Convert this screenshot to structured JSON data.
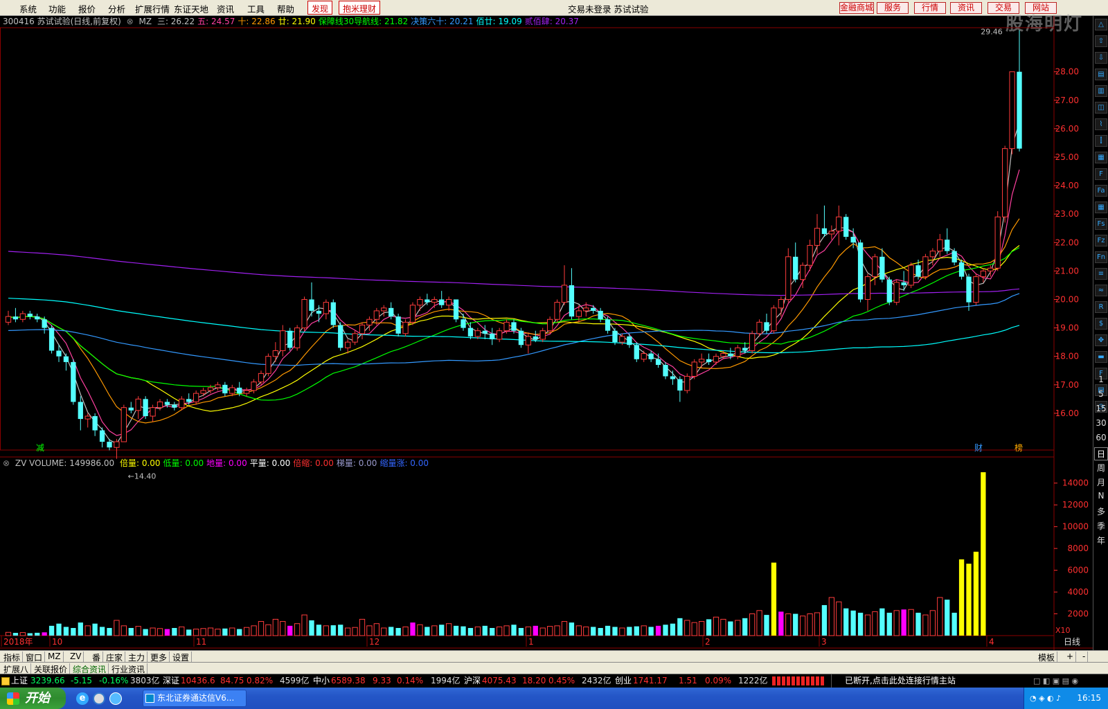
{
  "menu": {
    "items": [
      "系统",
      "功能",
      "报价",
      "分析",
      "扩展行情",
      "东证天地",
      "资讯",
      "工具",
      "帮助"
    ],
    "discover": "发现",
    "bao": "抱米理财",
    "center": "交易未登录  苏试试验",
    "right_buttons": [
      "金融商城",
      "服务",
      "行情",
      "资讯",
      "交易",
      "网站"
    ],
    "watermark": "股海明灯"
  },
  "header": {
    "code": "300416 苏试试验(日线,前复权)",
    "mz": "MZ",
    "items": [
      {
        "label": "三: 26.22",
        "color": "#c0c0c0"
      },
      {
        "label": "五: 24.57",
        "color": "#ff40a0"
      },
      {
        "label": "十: 22.86",
        "color": "#ff9900"
      },
      {
        "label": "廿: 21.90",
        "color": "#ffff00"
      },
      {
        "label": "保障线30导航线: 21.82",
        "color": "#00ff00"
      },
      {
        "label": "决策六十: 20.21",
        "color": "#3399ff"
      },
      {
        "label": "佰廿: 19.09",
        "color": "#00ffff"
      },
      {
        "label": "贰佰肆: 20.37",
        "color": "#a020f0"
      }
    ]
  },
  "chart_data": {
    "type": "candlestick",
    "y_axis": {
      "min": 15.0,
      "max": 29.5,
      "ticks": [
        16,
        17,
        18,
        19,
        20,
        21,
        22,
        23,
        24,
        25,
        26,
        27,
        28
      ]
    },
    "annotations": {
      "high": "29.46",
      "low": "14.40",
      "jian": "减",
      "cai": "财",
      "bang": "榜"
    },
    "x_months": [
      "2018年",
      "10",
      "11",
      "12",
      "1",
      "2",
      "3",
      "4"
    ],
    "period": "日线",
    "candles": [
      [
        19.2,
        19.6,
        19.1,
        19.4
      ],
      [
        19.4,
        19.7,
        19.2,
        19.3
      ],
      [
        19.3,
        19.6,
        19.2,
        19.5
      ],
      [
        19.5,
        19.6,
        19.3,
        19.4
      ],
      [
        19.4,
        19.5,
        19.2,
        19.3
      ],
      [
        19.3,
        19.4,
        18.8,
        19.0
      ],
      [
        19.0,
        19.1,
        18.1,
        18.2
      ],
      [
        18.2,
        18.4,
        17.8,
        18.0
      ],
      [
        18.0,
        18.1,
        17.5,
        17.8
      ],
      [
        17.8,
        17.9,
        16.3,
        16.4
      ],
      [
        16.4,
        16.6,
        15.4,
        15.8
      ],
      [
        15.8,
        16.0,
        15.5,
        15.9
      ],
      [
        15.9,
        16.0,
        15.2,
        15.4
      ],
      [
        15.4,
        15.5,
        14.8,
        15.0
      ],
      [
        15.0,
        15.1,
        14.7,
        14.8
      ],
      [
        14.8,
        15.1,
        14.4,
        15.0
      ],
      [
        15.0,
        16.3,
        15.0,
        16.2
      ],
      [
        16.2,
        16.4,
        16.0,
        16.1
      ],
      [
        16.1,
        16.6,
        15.8,
        16.5
      ],
      [
        16.5,
        16.6,
        15.8,
        15.9
      ],
      [
        15.9,
        16.3,
        15.7,
        16.2
      ],
      [
        16.2,
        16.5,
        16.1,
        16.4
      ],
      [
        16.4,
        16.5,
        16.2,
        16.3
      ],
      [
        16.3,
        16.4,
        16.1,
        16.2
      ],
      [
        16.2,
        16.6,
        16.1,
        16.5
      ],
      [
        16.5,
        16.7,
        16.3,
        16.4
      ],
      [
        16.4,
        16.8,
        16.3,
        16.7
      ],
      [
        16.7,
        16.9,
        16.6,
        16.8
      ],
      [
        16.8,
        17.0,
        16.7,
        16.9
      ],
      [
        16.9,
        17.1,
        16.8,
        17.0
      ],
      [
        17.0,
        17.1,
        16.6,
        16.7
      ],
      [
        16.7,
        17.0,
        16.6,
        16.9
      ],
      [
        16.9,
        17.1,
        16.6,
        16.7
      ],
      [
        16.7,
        16.9,
        16.6,
        16.8
      ],
      [
        16.8,
        17.2,
        16.7,
        17.1
      ],
      [
        17.1,
        17.5,
        17.0,
        17.4
      ],
      [
        17.4,
        18.1,
        17.3,
        18.0
      ],
      [
        18.0,
        18.5,
        17.8,
        18.2
      ],
      [
        18.2,
        19.1,
        18.0,
        18.9
      ],
      [
        18.9,
        19.0,
        18.2,
        18.3
      ],
      [
        18.3,
        19.1,
        18.2,
        19.0
      ],
      [
        19.0,
        20.1,
        18.9,
        20.0
      ],
      [
        20.0,
        20.6,
        19.4,
        19.6
      ],
      [
        19.6,
        19.8,
        19.2,
        19.5
      ],
      [
        19.5,
        20.0,
        19.3,
        19.9
      ],
      [
        19.9,
        20.0,
        19.0,
        19.1
      ],
      [
        19.1,
        19.2,
        18.2,
        18.3
      ],
      [
        18.3,
        18.6,
        18.1,
        18.5
      ],
      [
        18.5,
        18.9,
        18.4,
        18.8
      ],
      [
        18.8,
        19.2,
        18.6,
        19.1
      ],
      [
        19.1,
        19.4,
        18.9,
        19.3
      ],
      [
        19.3,
        19.7,
        19.1,
        19.6
      ],
      [
        19.6,
        19.8,
        19.4,
        19.7
      ],
      [
        19.7,
        19.9,
        19.3,
        19.4
      ],
      [
        19.4,
        19.5,
        18.7,
        18.8
      ],
      [
        18.8,
        19.3,
        18.7,
        19.2
      ],
      [
        19.2,
        19.9,
        19.1,
        19.8
      ],
      [
        19.8,
        20.1,
        19.6,
        20.0
      ],
      [
        20.0,
        20.2,
        19.8,
        19.9
      ],
      [
        19.9,
        20.1,
        19.7,
        20.0
      ],
      [
        20.0,
        20.3,
        19.7,
        19.8
      ],
      [
        19.8,
        20.1,
        19.6,
        20.0
      ],
      [
        20.0,
        20.0,
        19.2,
        19.3
      ],
      [
        19.3,
        19.5,
        18.9,
        19.0
      ],
      [
        19.0,
        19.2,
        18.6,
        18.7
      ],
      [
        18.7,
        19.0,
        18.6,
        18.9
      ],
      [
        18.9,
        19.1,
        18.6,
        18.8
      ],
      [
        18.8,
        19.0,
        18.4,
        18.6
      ],
      [
        18.6,
        19.0,
        18.5,
        18.9
      ],
      [
        18.9,
        19.3,
        18.8,
        19.2
      ],
      [
        19.2,
        19.3,
        18.8,
        18.9
      ],
      [
        18.9,
        19.0,
        18.3,
        18.4
      ],
      [
        18.4,
        18.8,
        18.1,
        18.7
      ],
      [
        18.7,
        18.9,
        18.5,
        18.6
      ],
      [
        18.6,
        19.0,
        18.5,
        18.9
      ],
      [
        18.9,
        19.4,
        18.8,
        19.3
      ],
      [
        19.3,
        20.0,
        19.2,
        19.9
      ],
      [
        19.9,
        21.2,
        19.8,
        20.5
      ],
      [
        20.5,
        21.1,
        19.3,
        19.4
      ],
      [
        19.4,
        19.8,
        19.2,
        19.6
      ],
      [
        19.6,
        19.9,
        19.4,
        19.7
      ],
      [
        19.7,
        19.8,
        19.5,
        19.6
      ],
      [
        19.6,
        19.7,
        19.2,
        19.3
      ],
      [
        19.3,
        19.4,
        18.8,
        18.9
      ],
      [
        18.9,
        19.0,
        18.4,
        18.5
      ],
      [
        18.5,
        18.8,
        18.4,
        18.7
      ],
      [
        18.7,
        18.8,
        18.3,
        18.4
      ],
      [
        18.4,
        18.5,
        17.8,
        17.9
      ],
      [
        17.9,
        18.2,
        17.8,
        18.1
      ],
      [
        18.1,
        18.2,
        17.8,
        17.9
      ],
      [
        17.9,
        18.1,
        17.6,
        17.7
      ],
      [
        17.7,
        17.8,
        17.2,
        17.3
      ],
      [
        17.3,
        17.5,
        17.0,
        17.2
      ],
      [
        17.2,
        17.3,
        16.4,
        16.8
      ],
      [
        16.8,
        17.4,
        16.7,
        17.3
      ],
      [
        17.3,
        17.9,
        17.2,
        17.8
      ],
      [
        17.8,
        18.1,
        17.6,
        17.9
      ],
      [
        17.9,
        18.1,
        17.7,
        17.8
      ],
      [
        17.8,
        18.1,
        17.7,
        18.0
      ],
      [
        18.0,
        18.2,
        17.9,
        18.1
      ],
      [
        18.1,
        18.3,
        17.9,
        18.0
      ],
      [
        18.0,
        18.4,
        17.9,
        18.3
      ],
      [
        18.3,
        18.5,
        18.1,
        18.2
      ],
      [
        18.2,
        18.9,
        18.1,
        18.8
      ],
      [
        18.8,
        19.3,
        18.7,
        19.2
      ],
      [
        19.2,
        19.5,
        18.8,
        18.9
      ],
      [
        18.9,
        19.8,
        18.8,
        19.7
      ],
      [
        19.7,
        20.1,
        19.4,
        20.0
      ],
      [
        20.0,
        21.8,
        19.9,
        21.5
      ],
      [
        21.5,
        22.0,
        20.6,
        20.7
      ],
      [
        20.7,
        21.3,
        20.4,
        21.2
      ],
      [
        21.2,
        22.1,
        21.0,
        21.9
      ],
      [
        21.9,
        23.0,
        21.6,
        22.5
      ],
      [
        22.5,
        23.3,
        22.2,
        22.3
      ],
      [
        22.3,
        22.6,
        22.1,
        22.4
      ],
      [
        22.4,
        23.3,
        21.9,
        22.9
      ],
      [
        22.9,
        23.0,
        22.1,
        22.2
      ],
      [
        22.2,
        22.5,
        21.8,
        22.0
      ],
      [
        22.0,
        22.1,
        19.9,
        20.0
      ],
      [
        20.0,
        20.9,
        19.6,
        20.8
      ],
      [
        20.8,
        21.6,
        20.5,
        21.5
      ],
      [
        21.5,
        21.8,
        20.6,
        20.7
      ],
      [
        20.7,
        20.8,
        19.8,
        19.9
      ],
      [
        19.9,
        20.7,
        19.8,
        20.6
      ],
      [
        20.6,
        21.0,
        20.3,
        20.5
      ],
      [
        20.5,
        21.3,
        20.4,
        21.2
      ],
      [
        21.2,
        21.4,
        20.7,
        20.8
      ],
      [
        20.8,
        21.6,
        20.7,
        21.5
      ],
      [
        21.5,
        21.8,
        21.2,
        21.7
      ],
      [
        21.7,
        22.3,
        21.5,
        22.1
      ],
      [
        22.1,
        22.5,
        21.6,
        21.7
      ],
      [
        21.7,
        21.8,
        21.2,
        21.3
      ],
      [
        21.3,
        21.4,
        20.7,
        20.8
      ],
      [
        20.8,
        20.9,
        19.6,
        19.9
      ],
      [
        19.9,
        20.9,
        19.8,
        20.8
      ],
      [
        20.8,
        21.1,
        20.6,
        21.0
      ],
      [
        21.0,
        21.2,
        20.8,
        21.1
      ],
      [
        21.1,
        23.1,
        21.0,
        22.9
      ],
      [
        22.9,
        25.4,
        22.7,
        25.3
      ],
      [
        25.3,
        28.0,
        25.1,
        28.0
      ],
      [
        28.0,
        29.46,
        25.2,
        25.3
      ]
    ],
    "ma": [
      {
        "name": "三",
        "color": "#c0c0c0",
        "end": 26.22
      },
      {
        "name": "五",
        "color": "#ff40a0",
        "end": 24.57
      },
      {
        "name": "十",
        "color": "#ff9900",
        "end": 22.86
      },
      {
        "name": "廿",
        "color": "#ffff00",
        "end": 21.9
      },
      {
        "name": "保障线30导航线",
        "color": "#00ff00",
        "end": 21.82
      },
      {
        "name": "决策六十",
        "color": "#3399ff",
        "end": 20.21
      },
      {
        "name": "佰廿",
        "color": "#00ffff",
        "end": 19.09
      },
      {
        "name": "贰佰肆",
        "color": "#a020f0",
        "end": 20.37
      }
    ],
    "volume": {
      "y_axis": {
        "min": 0,
        "max": 15000,
        "ticks": [
          2000,
          4000,
          6000,
          8000,
          10000,
          12000,
          14000
        ]
      },
      "unit": "X10",
      "values": [
        300,
        250,
        280,
        220,
        260,
        300,
        900,
        1100,
        800,
        700,
        1200,
        900,
        1100,
        800,
        700,
        1400,
        900,
        700,
        850,
        600,
        700,
        650,
        600,
        700,
        800,
        550,
        600,
        650,
        700,
        600,
        650,
        700,
        600,
        750,
        900,
        1300,
        1000,
        1500,
        1300,
        900,
        1100,
        1900,
        1400,
        1000,
        900,
        950,
        1000,
        700,
        750,
        1500,
        900,
        1100,
        700,
        800,
        700,
        800,
        1200,
        1000,
        800,
        900,
        1000,
        1100,
        900,
        850,
        700,
        800,
        900,
        700,
        800,
        900,
        1000,
        700,
        800,
        900,
        700,
        850,
        900,
        1300,
        1200,
        900,
        800,
        800,
        700,
        900,
        800,
        700,
        800,
        850,
        900,
        800,
        900,
        1000,
        1100,
        1600,
        1400,
        1200,
        1300,
        1500,
        1700,
        1500,
        1300,
        1400,
        1600,
        2000,
        2300,
        1900,
        6700,
        2200,
        2000,
        2000,
        1800,
        2000,
        2100,
        2800,
        3500,
        3100,
        2500,
        2300,
        2100,
        1900,
        2200,
        2500,
        2100,
        2300,
        2400,
        2400,
        2100,
        1900,
        2300,
        3500,
        3300,
        2100,
        7000,
        6600,
        7700,
        14998
      ],
      "header_label": "ZV  VOLUME: 149986.00",
      "items": [
        {
          "label": "倍量: 0.00",
          "color": "#ffff00"
        },
        {
          "label": "低量: 0.00",
          "color": "#00ff00"
        },
        {
          "label": "地量: 0.00",
          "color": "#ff00ff"
        },
        {
          "label": "平量: 0.00",
          "color": "#ffffff"
        },
        {
          "label": "倍缩: 0.00",
          "color": "#ff3030"
        },
        {
          "label": "梯量: 0.00",
          "color": "#9999cc"
        },
        {
          "label": "缩量涨: 0.00",
          "color": "#3366ff"
        }
      ]
    }
  },
  "tabs1": [
    "指标",
    "窗口",
    "MZ",
    "ZV",
    "番",
    "庄家",
    "主力",
    "更多",
    "设置"
  ],
  "tabs1_right": [
    "模板",
    "+",
    "-"
  ],
  "tabs2": [
    "扩展八",
    "关联报价",
    "综合资讯",
    "行业资讯"
  ],
  "status": {
    "sh": {
      "name": "上证",
      "price": "3239.66",
      "chg": "-5.15",
      "pct": "-0.16%",
      "amt": "3803亿"
    },
    "sz": {
      "name": "深证",
      "price": "10436.6",
      "chg": "84.75",
      "pct": "0.82%",
      "amt": "4599亿"
    },
    "zx": {
      "name": "中小",
      "price": "6589.38",
      "chg": "9.33",
      "pct": "0.14%",
      "amt": "1994亿"
    },
    "hs": {
      "name": "沪深",
      "price": "4075.43",
      "chg": "18.20",
      "pct": "0.45%",
      "amt": "2432亿"
    },
    "cy": {
      "name": "创业",
      "price": "1741.17",
      "chg": "1.51",
      "pct": "0.09%",
      "amt": "1222亿"
    },
    "msg": "已断开,点击此处连接行情主站"
  },
  "taskbar": {
    "start": "开始",
    "app": "东北证券通达信V6...",
    "clock": "16:15"
  },
  "right_toolbar": {
    "periods": [
      "1",
      "5",
      "15",
      "30",
      "60",
      "日",
      "周",
      "月",
      "N",
      "多",
      "季",
      "年"
    ]
  }
}
